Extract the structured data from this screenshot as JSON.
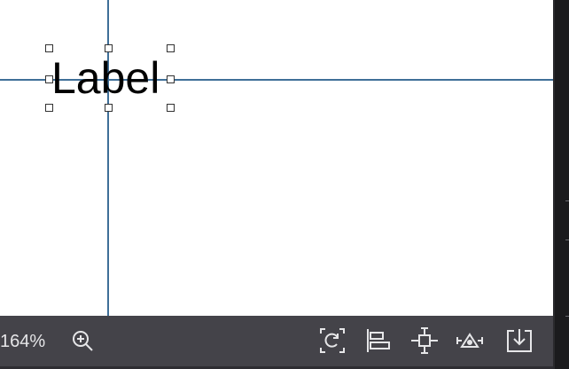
{
  "canvas": {
    "widget_text": "Label"
  },
  "toolbar": {
    "zoom_level": "164%",
    "icons": [
      "zoom-in-icon",
      "refresh-layout-icon",
      "align-left-icon",
      "center-fit-icon",
      "anchor-icon",
      "embed-icon"
    ]
  },
  "colors": {
    "guide": "#3f6f98",
    "toolbar_bg": "#444349",
    "canvas_bg": "#ffffff"
  }
}
